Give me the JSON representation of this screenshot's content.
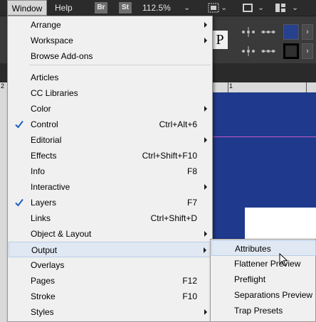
{
  "menubar": {
    "window_label": "Window",
    "help_label": "Help",
    "bridge_badge": "Br",
    "stock_badge": "St",
    "zoom": "112.5%"
  },
  "ruler": {
    "left_num": "2",
    "mid_num": "1"
  },
  "control_panel": {
    "paragraph_glyph": "P"
  },
  "window_menu": {
    "items": [
      {
        "label": "Arrange",
        "shortcut": "",
        "submenu": true,
        "checked": false
      },
      {
        "label": "Workspace",
        "shortcut": "",
        "submenu": true,
        "checked": false
      },
      {
        "label": "Browse Add-ons",
        "shortcut": "",
        "submenu": false,
        "checked": false
      },
      {
        "label": "Articles",
        "shortcut": "",
        "submenu": false,
        "checked": false
      },
      {
        "label": "CC Libraries",
        "shortcut": "",
        "submenu": false,
        "checked": false
      },
      {
        "label": "Color",
        "shortcut": "",
        "submenu": true,
        "checked": false
      },
      {
        "label": "Control",
        "shortcut": "Ctrl+Alt+6",
        "submenu": false,
        "checked": true
      },
      {
        "label": "Editorial",
        "shortcut": "",
        "submenu": true,
        "checked": false
      },
      {
        "label": "Effects",
        "shortcut": "Ctrl+Shift+F10",
        "submenu": false,
        "checked": false
      },
      {
        "label": "Info",
        "shortcut": "F8",
        "submenu": false,
        "checked": false
      },
      {
        "label": "Interactive",
        "shortcut": "",
        "submenu": true,
        "checked": false
      },
      {
        "label": "Layers",
        "shortcut": "F7",
        "submenu": false,
        "checked": true
      },
      {
        "label": "Links",
        "shortcut": "Ctrl+Shift+D",
        "submenu": false,
        "checked": false
      },
      {
        "label": "Object & Layout",
        "shortcut": "",
        "submenu": true,
        "checked": false
      },
      {
        "label": "Output",
        "shortcut": "",
        "submenu": true,
        "checked": false,
        "highlighted": true
      },
      {
        "label": "Overlays",
        "shortcut": "",
        "submenu": false,
        "checked": false
      },
      {
        "label": "Pages",
        "shortcut": "F12",
        "submenu": false,
        "checked": false
      },
      {
        "label": "Stroke",
        "shortcut": "F10",
        "submenu": false,
        "checked": false
      },
      {
        "label": "Styles",
        "shortcut": "",
        "submenu": true,
        "checked": false
      }
    ]
  },
  "output_submenu": {
    "items": [
      {
        "label": "Attributes",
        "highlighted": true
      },
      {
        "label": "Flattener Preview"
      },
      {
        "label": "Preflight"
      },
      {
        "label": "Separations Preview"
      },
      {
        "label": "Trap Presets"
      }
    ]
  },
  "colors": {
    "pasteboard": "#1f3a8c",
    "menu_bg": "#f0f0f0",
    "hover_bg": "#e0e8f3",
    "check": "#1f5fbf",
    "guide": "#c857c8"
  }
}
